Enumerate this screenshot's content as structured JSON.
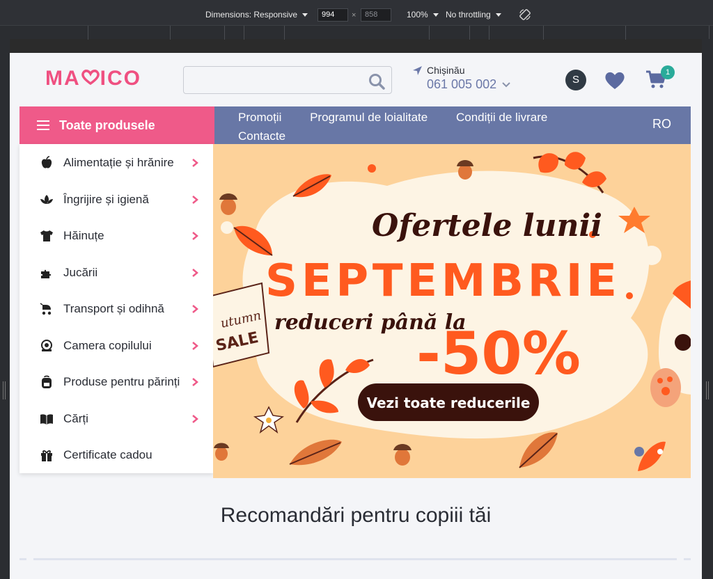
{
  "devtools": {
    "dimensions_label": "Dimensions: Responsive",
    "width_value": "994",
    "height_placeholder": "858",
    "zoom": "100%",
    "throttling": "No throttling"
  },
  "header": {
    "logo_left": "MA",
    "logo_right": "ICO",
    "search_placeholder": "",
    "city": "Chișinău",
    "phone": "061 005 002",
    "avatar_letter": "S",
    "cart_count": "1"
  },
  "nav": {
    "all_products": "Toate produsele",
    "links": [
      "Promoții",
      "Programul de loialitate",
      "Condiții de livrare",
      "Contacte"
    ],
    "language": "RO"
  },
  "side_menu": {
    "items": [
      {
        "label": "Alimentație și hrănire",
        "icon": "apple-icon",
        "has_arrow": true
      },
      {
        "label": "Îngrijire și igienă",
        "icon": "lotus-icon",
        "has_arrow": true
      },
      {
        "label": "Hăinuțe",
        "icon": "tshirt-icon",
        "has_arrow": true
      },
      {
        "label": "Jucării",
        "icon": "puzzle-icon",
        "has_arrow": true
      },
      {
        "label": "Transport și odihnă",
        "icon": "stroller-icon",
        "has_arrow": true
      },
      {
        "label": "Camera copilului",
        "icon": "baby-room-icon",
        "has_arrow": true
      },
      {
        "label": "Produse pentru părinți",
        "icon": "backpack-icon",
        "has_arrow": true
      },
      {
        "label": "Cărți",
        "icon": "book-icon",
        "has_arrow": true
      },
      {
        "label": "Certificate cadou",
        "icon": "gift-icon",
        "has_arrow": false
      }
    ]
  },
  "banner": {
    "line1": "Ofertele lunii",
    "line2": "SEPTEMBRIE",
    "line3": "reduceri până la",
    "discount": "-50%",
    "cta": "Vezi toate reducerile",
    "tag_line1": "utumn",
    "tag_line2": "SALE"
  },
  "recommendations_title": "Recomandări pentru copiii tăi",
  "colors": {
    "brand_pink": "#ef5a89",
    "nav_blue": "#6877a6",
    "banner_bg": "#fdd29a",
    "accent_orange": "#ff5a1f",
    "dark_brown": "#3a120c"
  }
}
